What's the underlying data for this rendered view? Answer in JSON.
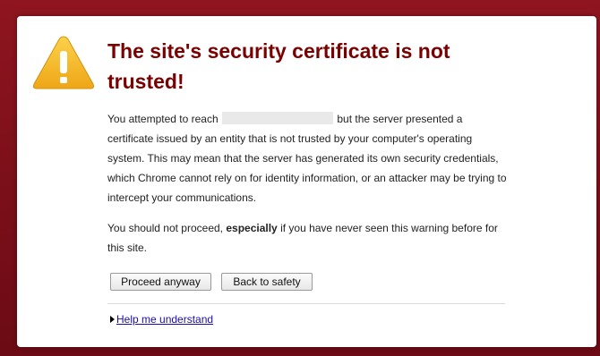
{
  "colors": {
    "background": "#7a0f19",
    "title": "#7b0000",
    "link": "#1a0dab",
    "warning_icon": "#f2b21b"
  },
  "icon": "warning-icon",
  "title": "The site's security certificate is not trusted!",
  "paragraph1": {
    "before_host": "You attempted to reach",
    "after_host": "but the server presented a certificate issued by an entity that is not trusted by your computer's operating system. This may mean that the server has generated its own security credentials, which Chrome cannot rely on for identity information, or an attacker may be trying to intercept your communications."
  },
  "paragraph2": {
    "before_bold": "You should not proceed,",
    "bold": "especially",
    "after_bold": "if you have never seen this warning before for this site."
  },
  "buttons": {
    "proceed": "Proceed anyway",
    "back": "Back to safety"
  },
  "help_link": "Help me understand"
}
